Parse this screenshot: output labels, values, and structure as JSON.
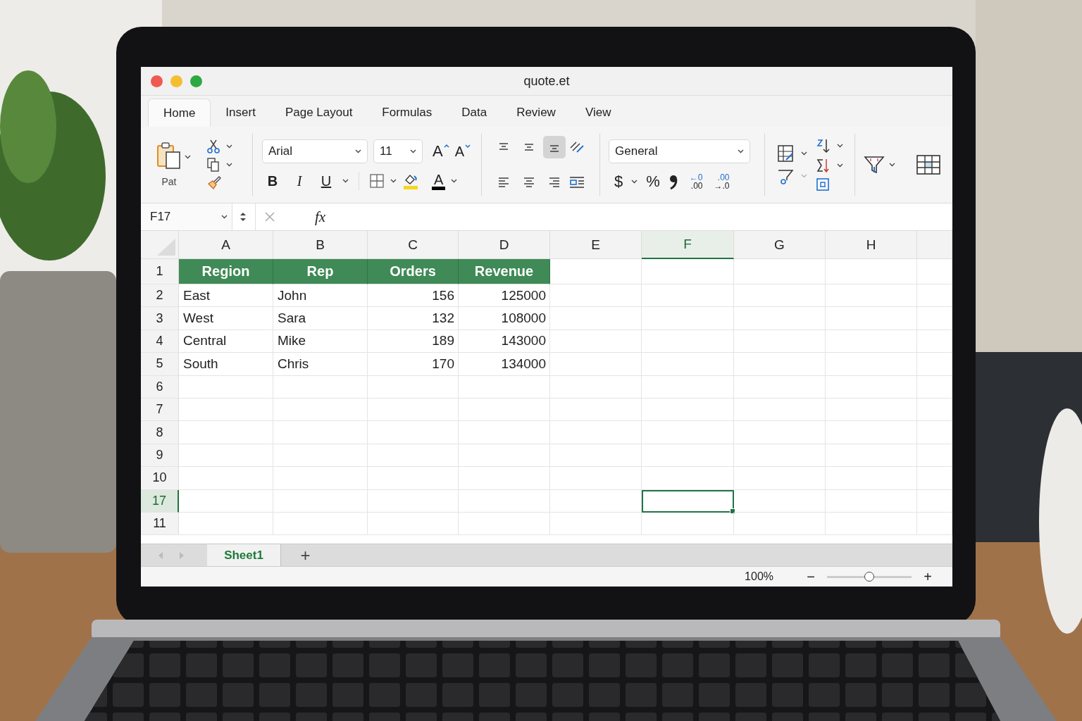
{
  "window": {
    "title": "quote.et"
  },
  "tabs": [
    {
      "label": "Home",
      "selected": true
    },
    {
      "label": "Insert",
      "selected": false
    },
    {
      "label": "Page Layout",
      "selected": false
    },
    {
      "label": "Formulas",
      "selected": false
    },
    {
      "label": "Data",
      "selected": false
    },
    {
      "label": "Review",
      "selected": false
    },
    {
      "label": "View",
      "selected": false
    }
  ],
  "ribbon": {
    "paste_label": "Pat",
    "font": "Arial",
    "font_size": "11",
    "grow_font": "A",
    "shrink_font": "A",
    "style_buttons": [
      "B",
      "I",
      "U"
    ],
    "font_color": "A",
    "align_buttons": [
      {
        "kind": "top",
        "selected": false
      },
      {
        "kind": "middle",
        "selected": false
      },
      {
        "kind": "bottom",
        "selected": true
      },
      {
        "kind": "left",
        "selected": false
      },
      {
        "kind": "center",
        "selected": false
      },
      {
        "kind": "right",
        "selected": false
      }
    ],
    "number_format": "General",
    "currency": "$",
    "percent": "%",
    "decimals": [
      {
        "top": "←0",
        "bottom": ".00"
      },
      {
        "top": ".00",
        "bottom": "→.0"
      }
    ]
  },
  "formula_bar": {
    "name_box": "F17",
    "function_label": "fx"
  },
  "columns": [
    {
      "label": "A",
      "selected": false,
      "kind": "text"
    },
    {
      "label": "B",
      "selected": false,
      "kind": "text"
    },
    {
      "label": "C",
      "selected": false,
      "kind": "number"
    },
    {
      "label": "D",
      "selected": false,
      "kind": "number"
    },
    {
      "label": "E",
      "selected": false
    },
    {
      "label": "F",
      "selected": true
    },
    {
      "label": "G",
      "selected": false
    },
    {
      "label": "H",
      "selected": false
    }
  ],
  "rows": [
    {
      "label": "1",
      "selected": false,
      "kind": "header",
      "cells": [
        "Region",
        "Rep",
        "Orders",
        "Revenue"
      ]
    },
    {
      "label": "2",
      "selected": false,
      "kind": "data",
      "cells": [
        "East",
        "John",
        "156",
        "125000"
      ]
    },
    {
      "label": "3",
      "selected": false,
      "kind": "data",
      "cells": [
        "West",
        "Sara",
        "132",
        "108000"
      ]
    },
    {
      "label": "4",
      "selected": false,
      "kind": "data",
      "cells": [
        "Central",
        "Mike",
        "189",
        "143000"
      ]
    },
    {
      "label": "5",
      "selected": false,
      "kind": "data",
      "cells": [
        "South",
        "Chris",
        "170",
        "134000"
      ]
    },
    {
      "label": "6",
      "selected": false,
      "cells": []
    },
    {
      "label": "7",
      "selected": false,
      "cells": []
    },
    {
      "label": "8",
      "selected": false,
      "cells": []
    },
    {
      "label": "9",
      "selected": false,
      "cells": []
    },
    {
      "label": "10",
      "selected": false,
      "cells": []
    },
    {
      "label": "17",
      "selected": true,
      "cells": []
    },
    {
      "label": "11",
      "selected": false,
      "cells": []
    }
  ],
  "sheet_tabs": [
    {
      "label": "Sheet1",
      "selected": true
    }
  ],
  "add_sheet": "+",
  "status_bar": {
    "zoom": "100%",
    "zoom_out": "−",
    "zoom_in": "+",
    "zoom_slider": {
      "level": 0.5
    }
  }
}
